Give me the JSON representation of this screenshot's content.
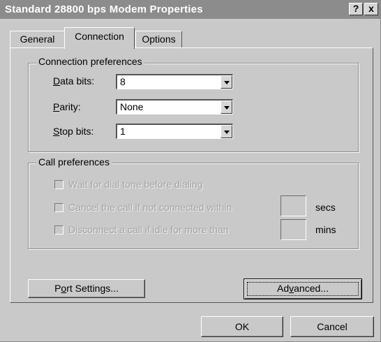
{
  "window": {
    "title": "Standard 28800 bps Modem Properties",
    "help_label": "?",
    "close_label": "x"
  },
  "tabs": [
    {
      "label": "General",
      "active": false
    },
    {
      "label": "Connection",
      "active": true
    },
    {
      "label": "Options",
      "active": false
    }
  ],
  "connection_preferences": {
    "title": "Connection preferences",
    "data_bits": {
      "label_mnemonic": "D",
      "label_rest": "ata bits:",
      "value": "8"
    },
    "parity": {
      "label_mnemonic": "P",
      "label_rest": "arity:",
      "value": "None"
    },
    "stop_bits": {
      "label_mnemonic": "S",
      "label_rest": "top bits:",
      "value": "1"
    }
  },
  "call_preferences": {
    "title": "Call preferences",
    "wait_dial_tone": {
      "label": "Wait for dial tone before dialing",
      "checked": false,
      "enabled": false
    },
    "cancel_call": {
      "label": "Cancel the call if not connected within",
      "checked": false,
      "enabled": false,
      "unit": "secs",
      "value": ""
    },
    "disconnect_idle": {
      "label": "Disconnect a call if idle for more than",
      "checked": false,
      "enabled": false,
      "unit": "mins",
      "value": ""
    }
  },
  "buttons": {
    "port_settings_pre": "P",
    "port_settings_mnemonic": "o",
    "port_settings_post": "rt Settings...",
    "advanced_pre": "Ad",
    "advanced_mnemonic": "v",
    "advanced_post": "anced...",
    "ok": "OK",
    "cancel": "Cancel"
  }
}
